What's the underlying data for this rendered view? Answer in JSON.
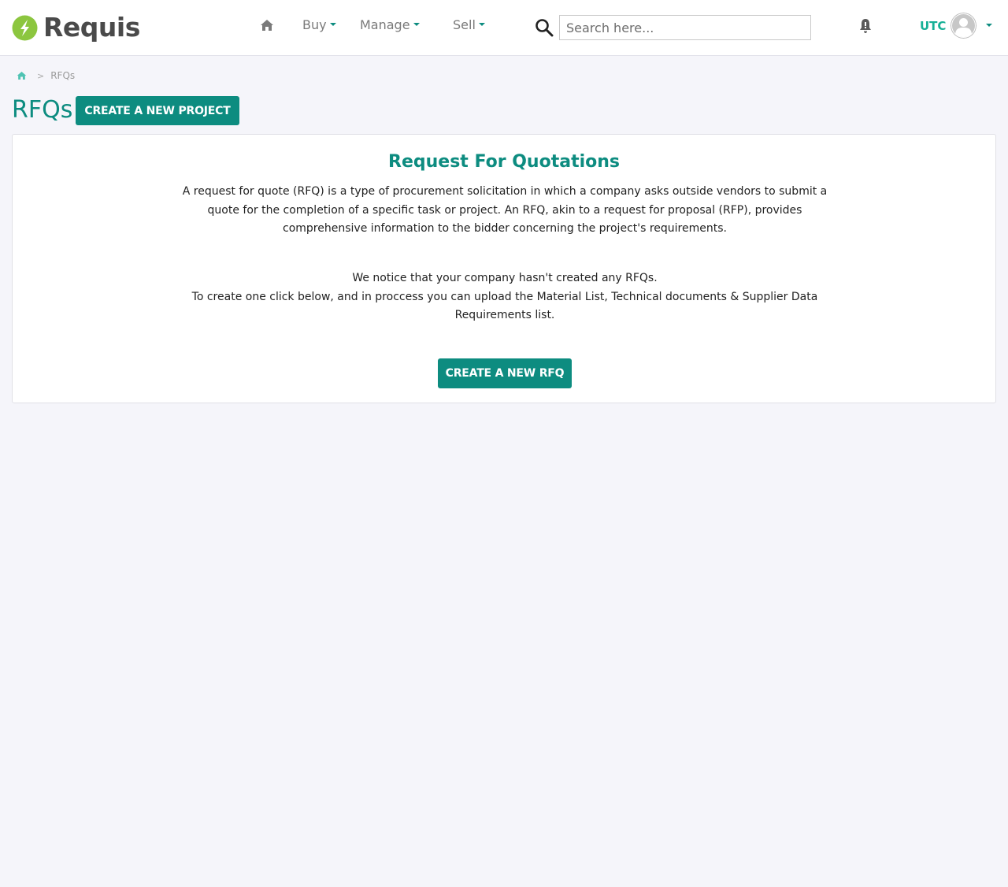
{
  "brand": {
    "name": "Requis"
  },
  "nav": {
    "items": [
      {
        "label": "Buy"
      },
      {
        "label": "Manage"
      },
      {
        "label": "Sell"
      }
    ],
    "search": {
      "placeholder": "Search here..."
    },
    "timezone": "UTC"
  },
  "breadcrumb": {
    "current": "RFQs"
  },
  "page": {
    "title": "RFQs",
    "create_project_label": "CREATE A NEW PROJECT"
  },
  "card": {
    "title": "Request For Quotations",
    "intro": "A request for quote (RFQ) is a type of procurement solicitation in which a company asks outside vendors to submit a quote for the completion of a specific task or project. An RFQ, akin to a request for proposal (RFP), provides comprehensive information to the bidder concerning the project's requirements.",
    "empty_notice": "We notice that your company hasn't created any RFQs.",
    "instructions": "To create one click below, and in proccess you can upload the Material List, Technical documents & Supplier Data Requirements list.",
    "create_rfq_label": "CREATE A NEW RFQ"
  },
  "colors": {
    "accent": "#0d8c80",
    "logo_green": "#8cc63f",
    "timezone": "#16b096",
    "background": "#f5f5fa"
  },
  "icons": [
    "requis-logo-icon",
    "home-icon",
    "search-icon",
    "bell-icon",
    "avatar-icon",
    "chevron-right-icon"
  ]
}
